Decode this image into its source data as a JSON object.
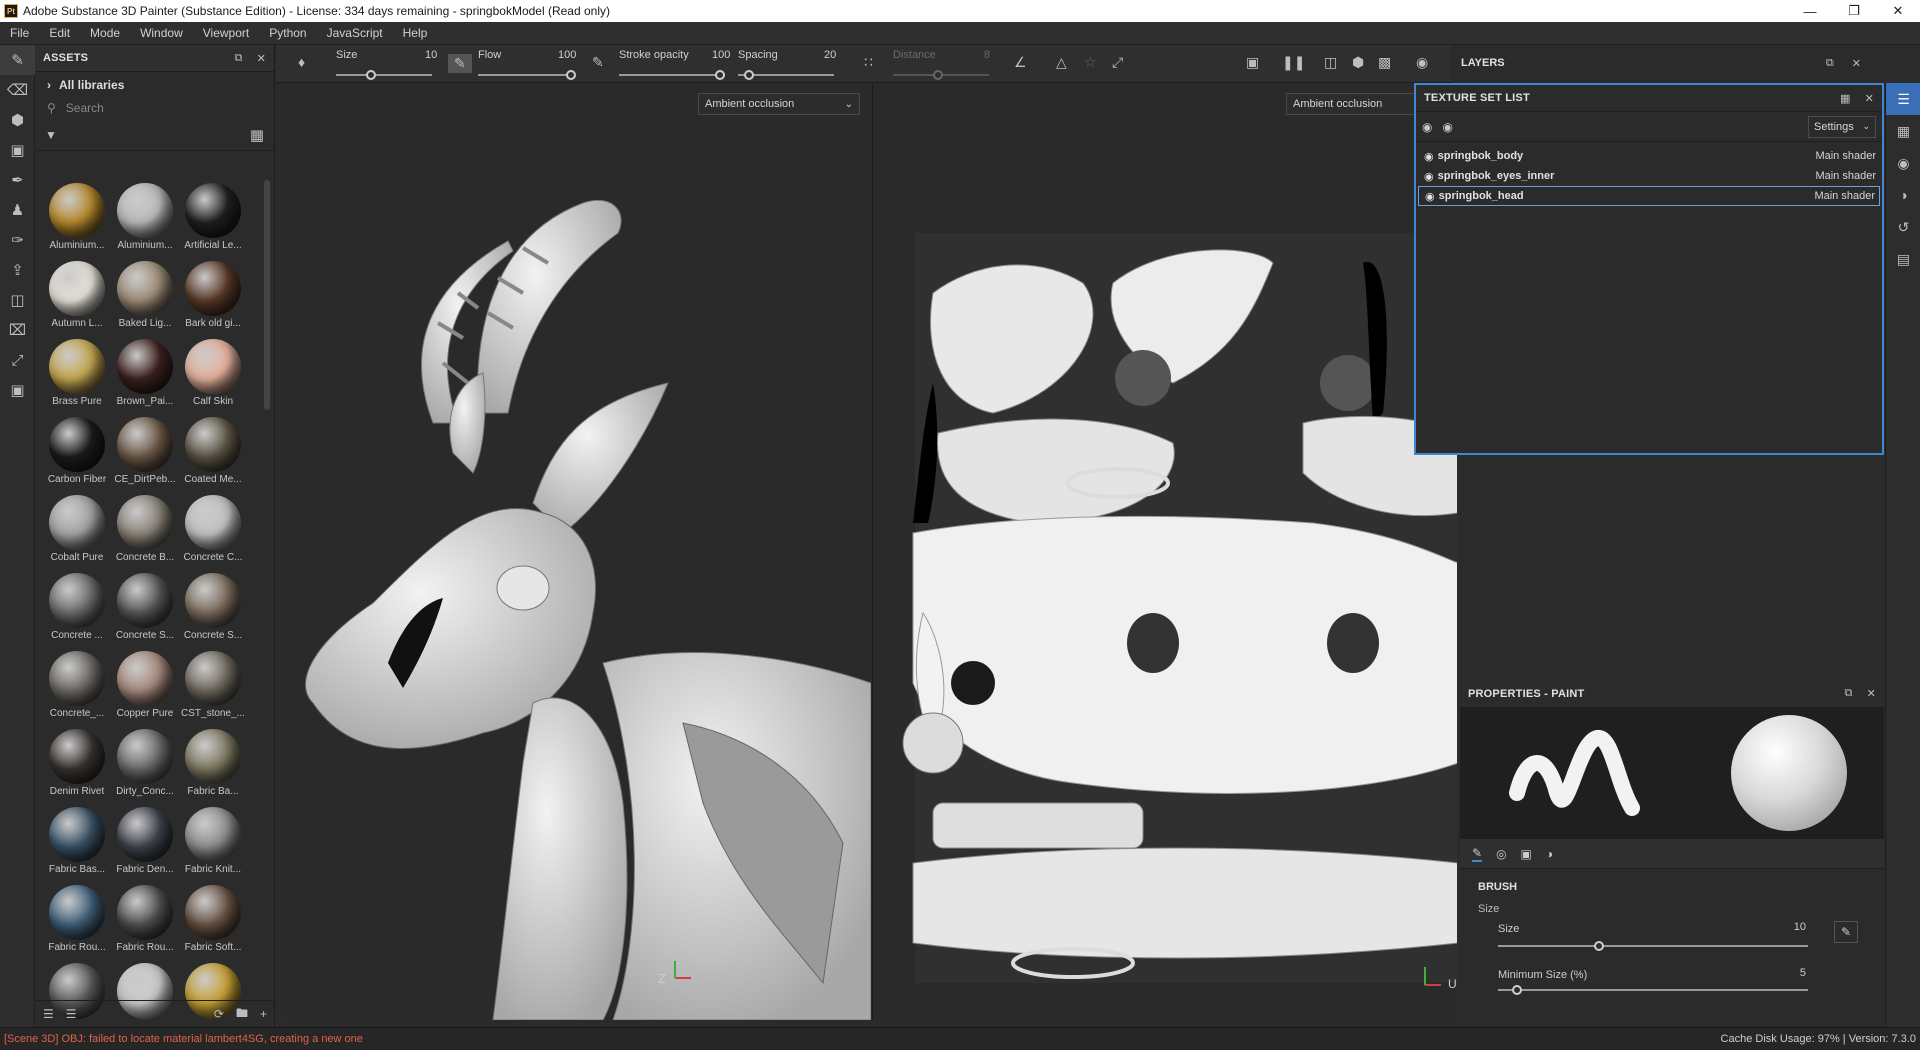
{
  "titlebar": {
    "app_icon": "Pt",
    "title": "Adobe Substance 3D Painter (Substance Edition) - License: 334 days remaining - springbokModel (Read only)"
  },
  "menu": [
    "File",
    "Edit",
    "Mode",
    "Window",
    "Viewport",
    "Python",
    "JavaScript",
    "Help"
  ],
  "assets": {
    "title": "ASSETS",
    "library": "All libraries",
    "search_placeholder": "Search",
    "materials": [
      {
        "label": "Aluminium...",
        "color": "#b98a2c"
      },
      {
        "label": "Aluminium...",
        "color": "#bdbdbd"
      },
      {
        "label": "Artificial Le...",
        "color": "#202020"
      },
      {
        "label": "Autumn L...",
        "color": "#e9e4dc"
      },
      {
        "label": "Baked Lig...",
        "color": "#a08e78"
      },
      {
        "label": "Bark old gi...",
        "color": "#5a3a28"
      },
      {
        "label": "Brass Pure",
        "color": "#c8aa52"
      },
      {
        "label": "Brown_Pai...",
        "color": "#3e2220"
      },
      {
        "label": "Calf Skin",
        "color": "#e9b49e"
      },
      {
        "label": "Carbon Fiber",
        "color": "#1c1c1c"
      },
      {
        "label": "CE_DirtPeb...",
        "color": "#6e5a48"
      },
      {
        "label": "Coated Me...",
        "color": "#5e5646"
      },
      {
        "label": "Cobalt Pure",
        "color": "#a5a5a5"
      },
      {
        "label": "Concrete B...",
        "color": "#8c857a"
      },
      {
        "label": "Concrete C...",
        "color": "#c4c4c4"
      },
      {
        "label": "Concrete ...",
        "color": "#6d6d6d"
      },
      {
        "label": "Concrete S...",
        "color": "#575757"
      },
      {
        "label": "Concrete S...",
        "color": "#7d6e5e"
      },
      {
        "label": "Concrete_...",
        "color": "#6f6a64"
      },
      {
        "label": "Copper Pure",
        "color": "#a98b80"
      },
      {
        "label": "CST_stone_...",
        "color": "#70695f"
      },
      {
        "label": "Denim Rivet",
        "color": "#3a3430"
      },
      {
        "label": "Dirty_Conc...",
        "color": "#6c6c6c"
      },
      {
        "label": "Fabric Ba...",
        "color": "#807b64"
      },
      {
        "label": "Fabric Bas...",
        "color": "#3a5468"
      },
      {
        "label": "Fabric Den...",
        "color": "#3f444c"
      },
      {
        "label": "Fabric Knit...",
        "color": "#909090"
      },
      {
        "label": "Fabric Rou...",
        "color": "#40607a"
      },
      {
        "label": "Fabric Rou...",
        "color": "#505050"
      },
      {
        "label": "Fabric Soft...",
        "color": "#6a5444"
      },
      {
        "label": "",
        "color": "#5a5a5a"
      },
      {
        "label": "",
        "color": "#cccccc"
      },
      {
        "label": "",
        "color": "#c8a232"
      }
    ]
  },
  "toolbar": {
    "size_label": "Size",
    "size_value": "10",
    "flow_label": "Flow",
    "flow_value": "100",
    "stroke_label": "Stroke opacity",
    "stroke_value": "100",
    "spacing_label": "Spacing",
    "spacing_value": "20",
    "distance_label": "Distance",
    "distance_value": "8"
  },
  "viewport": {
    "mode_3d": "Ambient occlusion",
    "mode_2d": "Ambient occlusion",
    "axis_3d": "Z",
    "axis_2d": "U"
  },
  "layers": {
    "title": "LAYERS"
  },
  "texture_set_list": {
    "title": "TEXTURE SET LIST",
    "settings_label": "Settings",
    "rows": [
      {
        "name": "springbok_body",
        "shader": "Main shader"
      },
      {
        "name": "springbok_eyes_inner",
        "shader": "Main shader"
      },
      {
        "name": "springbok_head",
        "shader": "Main shader"
      }
    ]
  },
  "properties": {
    "title": "PROPERTIES - PAINT",
    "section": "BRUSH",
    "subsection": "Size",
    "size_label": "Size",
    "size_value": "10",
    "minsize_label": "Minimum Size (%)",
    "minsize_value": "5"
  },
  "status": {
    "error": "[Scene 3D] OBJ: failed to locate material lambert4SG, creating a new one",
    "cache": "Cache Disk Usage:  97% | Version: 7.3.0"
  }
}
